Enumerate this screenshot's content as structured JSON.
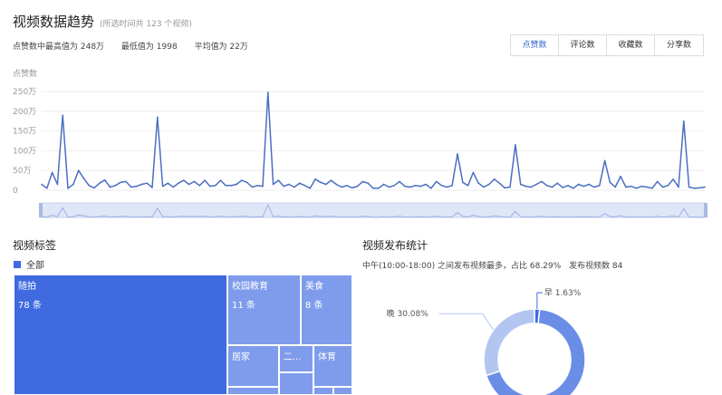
{
  "header": {
    "title": "视频数据趋势",
    "subtitle": "(所选时间共 123 个视频)"
  },
  "stats": {
    "max": "点赞数中最高值为 248万",
    "min": "最低值为 1998",
    "avg": "平均值为 22万"
  },
  "tabs": [
    {
      "label": "点赞数",
      "active": true
    },
    {
      "label": "评论数",
      "active": false
    },
    {
      "label": "收藏数",
      "active": false
    },
    {
      "label": "分享数",
      "active": false
    }
  ],
  "chart_data": {
    "type": "line",
    "ylabel": "点赞数",
    "ytick_labels": [
      "250万",
      "200万",
      "150万",
      "100万",
      "50万",
      "0"
    ],
    "ylim": [
      0,
      250
    ],
    "grid": true,
    "line_color": "#4a6fc2",
    "series": [
      {
        "values": [
          15,
          5,
          45,
          15,
          190,
          5,
          15,
          50,
          30,
          12,
          6,
          18,
          26,
          8,
          12,
          20,
          22,
          8,
          10,
          15,
          18,
          7,
          185,
          10,
          18,
          8,
          18,
          25,
          15,
          22,
          12,
          25,
          10,
          12,
          25,
          12,
          12,
          15,
          25,
          20,
          8,
          12,
          10,
          248,
          15,
          25,
          10,
          15,
          8,
          18,
          12,
          5,
          28,
          20,
          15,
          25,
          15,
          8,
          12,
          6,
          10,
          22,
          18,
          5,
          5,
          15,
          8,
          12,
          22,
          10,
          8,
          12,
          10,
          15,
          5,
          22,
          12,
          8,
          12,
          92,
          20,
          12,
          45,
          18,
          8,
          15,
          28,
          18,
          6,
          8,
          115,
          15,
          10,
          8,
          15,
          22,
          12,
          8,
          18,
          7,
          12,
          5,
          15,
          10,
          15,
          8,
          12,
          75,
          20,
          8,
          35,
          8,
          10,
          5,
          10,
          8,
          5,
          22,
          8,
          12,
          28,
          8,
          175,
          8,
          5,
          6,
          8
        ]
      }
    ]
  },
  "tags": {
    "title": "视频标签",
    "legend": "全部",
    "items": [
      {
        "label": "随拍",
        "count": "78 条"
      },
      {
        "label": "校园教育",
        "count": "11 条"
      },
      {
        "label": "美食",
        "count": "8 条"
      },
      {
        "label": "居家",
        "count": ""
      },
      {
        "label": "二...",
        "count": ""
      },
      {
        "label": "体育",
        "count": ""
      }
    ]
  },
  "publish": {
    "title": "视频发布统计",
    "summary": "中午(10:00-18:00) 之间发布视频最多，占比 68.29%",
    "count": "发布视频数 84",
    "slices": [
      {
        "label": "早 1.63%",
        "value": 1.63,
        "color": "#3f6ae0"
      },
      {
        "label": "中午",
        "value": 68.29,
        "color": "#6a8ee6"
      },
      {
        "label": "晚 30.08%",
        "value": 30.08,
        "color": "#b3c6f2"
      }
    ]
  }
}
